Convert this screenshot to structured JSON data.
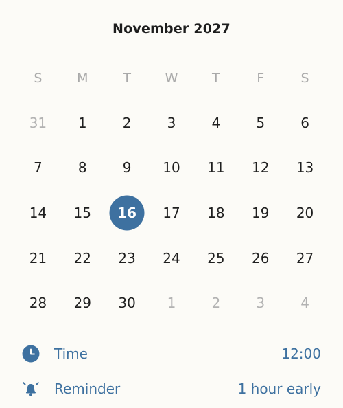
{
  "calendar": {
    "title": "November 2027",
    "weekdays": [
      "S",
      "M",
      "T",
      "W",
      "T",
      "F",
      "S"
    ],
    "days": [
      {
        "label": "31",
        "muted": true
      },
      {
        "label": "1"
      },
      {
        "label": "2"
      },
      {
        "label": "3"
      },
      {
        "label": "4"
      },
      {
        "label": "5"
      },
      {
        "label": "6"
      },
      {
        "label": "7"
      },
      {
        "label": "8"
      },
      {
        "label": "9"
      },
      {
        "label": "10"
      },
      {
        "label": "11"
      },
      {
        "label": "12"
      },
      {
        "label": "13"
      },
      {
        "label": "14"
      },
      {
        "label": "15"
      },
      {
        "label": "16",
        "selected": true
      },
      {
        "label": "17"
      },
      {
        "label": "18"
      },
      {
        "label": "19"
      },
      {
        "label": "20"
      },
      {
        "label": "21"
      },
      {
        "label": "22"
      },
      {
        "label": "23"
      },
      {
        "label": "24"
      },
      {
        "label": "25"
      },
      {
        "label": "26"
      },
      {
        "label": "27"
      },
      {
        "label": "28"
      },
      {
        "label": "29"
      },
      {
        "label": "30"
      },
      {
        "label": "1",
        "muted": true
      },
      {
        "label": "2",
        "muted": true
      },
      {
        "label": "3",
        "muted": true
      },
      {
        "label": "4",
        "muted": true
      }
    ]
  },
  "time": {
    "icon": "clock-icon",
    "label": "Time",
    "value": "12:00"
  },
  "reminder": {
    "icon": "bell-icon",
    "label": "Reminder",
    "value": "1 hour early"
  },
  "colors": {
    "accent": "#3e71a0",
    "background": "#fcfbf7",
    "muted_text": "#b2b2b2"
  }
}
